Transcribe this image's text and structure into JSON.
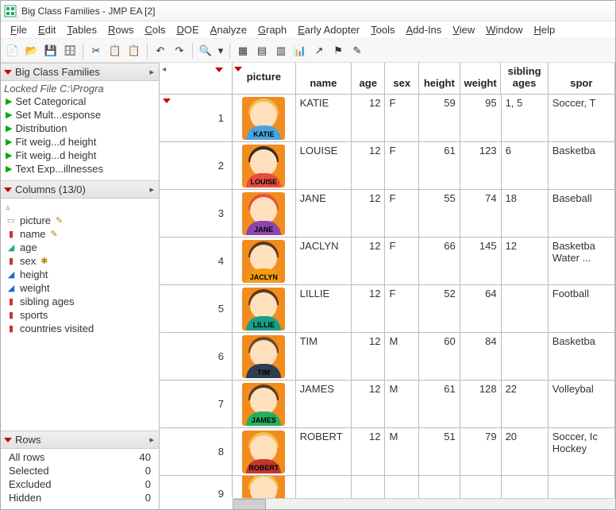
{
  "window": {
    "title": "Big Class Families - JMP EA [2]"
  },
  "menus": [
    "File",
    "Edit",
    "Tables",
    "Rows",
    "Cols",
    "DOE",
    "Analyze",
    "Graph",
    "Early Adopter",
    "Tools",
    "Add-Ins",
    "View",
    "Window",
    "Help"
  ],
  "left": {
    "tableName": "Big Class Families",
    "lockedPath": "Locked File  C:\\Progra",
    "scripts": [
      "Set Categorical",
      "Set Mult...esponse",
      "Distribution",
      "Fit weig...d height",
      "Fit weig...d height",
      "Text Exp...illnesses"
    ],
    "columnsHeader": "Columns (13/0)",
    "columns": [
      {
        "icon": "▭",
        "color": "#999",
        "label": "picture",
        "tag": "✎"
      },
      {
        "icon": "▮",
        "color": "#c33",
        "label": "name",
        "tag": "✎"
      },
      {
        "icon": "◢",
        "color": "#2a8",
        "label": "age",
        "tag": ""
      },
      {
        "icon": "▮",
        "color": "#c33",
        "label": "sex",
        "tag": "✱"
      },
      {
        "icon": "◢",
        "color": "#26c",
        "label": "height",
        "tag": ""
      },
      {
        "icon": "◢",
        "color": "#26c",
        "label": "weight",
        "tag": ""
      },
      {
        "icon": "▮",
        "color": "#c33",
        "label": "sibling ages",
        "tag": ""
      },
      {
        "icon": "▮",
        "color": "#c33",
        "label": "sports",
        "tag": ""
      },
      {
        "icon": "▮",
        "color": "#c33",
        "label": "countries visited",
        "tag": ""
      }
    ],
    "rowsHeader": "Rows",
    "rowStats": [
      {
        "label": "All rows",
        "value": "40"
      },
      {
        "label": "Selected",
        "value": "0"
      },
      {
        "label": "Excluded",
        "value": "0"
      },
      {
        "label": "Hidden",
        "value": "0"
      }
    ]
  },
  "grid": {
    "headers": [
      "picture",
      "name",
      "age",
      "sex",
      "height",
      "weight",
      "sibling ages",
      "spor"
    ],
    "rows": [
      {
        "n": "1",
        "name": "KATIE",
        "age": "12",
        "sex": "F",
        "h": "59",
        "w": "95",
        "sib": "1, 5",
        "sport": "Soccer, T",
        "hair": "#f2c14e",
        "body": "#4aa3df"
      },
      {
        "n": "2",
        "name": "LOUISE",
        "age": "12",
        "sex": "F",
        "h": "61",
        "w": "123",
        "sib": "6",
        "sport": "Basketba",
        "hair": "#3a2a1a",
        "body": "#e74c3c"
      },
      {
        "n": "3",
        "name": "JANE",
        "age": "12",
        "sex": "F",
        "h": "55",
        "w": "74",
        "sib": "18",
        "sport": "Baseball",
        "hair": "#e74c3c",
        "body": "#8e44ad"
      },
      {
        "n": "4",
        "name": "JACLYN",
        "age": "12",
        "sex": "F",
        "h": "66",
        "w": "145",
        "sib": "12",
        "sport": "Basketba Water ...",
        "hair": "#5a3a1a",
        "body": "#f39c12"
      },
      {
        "n": "5",
        "name": "LILLIE",
        "age": "12",
        "sex": "F",
        "h": "52",
        "w": "64",
        "sib": "",
        "sport": "Football",
        "hair": "#5a3a1a",
        "body": "#16a085"
      },
      {
        "n": "6",
        "name": "TIM",
        "age": "12",
        "sex": "M",
        "h": "60",
        "w": "84",
        "sib": "",
        "sport": "Basketba",
        "hair": "#6b4a2a",
        "body": "#2c3e50"
      },
      {
        "n": "7",
        "name": "JAMES",
        "age": "12",
        "sex": "M",
        "h": "61",
        "w": "128",
        "sib": "22",
        "sport": "Volleybal",
        "hair": "#5a3a1a",
        "body": "#27ae60"
      },
      {
        "n": "8",
        "name": "ROBERT",
        "age": "12",
        "sex": "M",
        "h": "51",
        "w": "79",
        "sib": "20",
        "sport": "Soccer, Ic Hockey",
        "hair": "#f2c14e",
        "body": "#c0392b"
      },
      {
        "n": "9",
        "name": "",
        "age": "",
        "sex": "",
        "h": "",
        "w": "",
        "sib": "",
        "sport": "",
        "hair": "#f2c14e",
        "body": "#3498db"
      }
    ]
  }
}
